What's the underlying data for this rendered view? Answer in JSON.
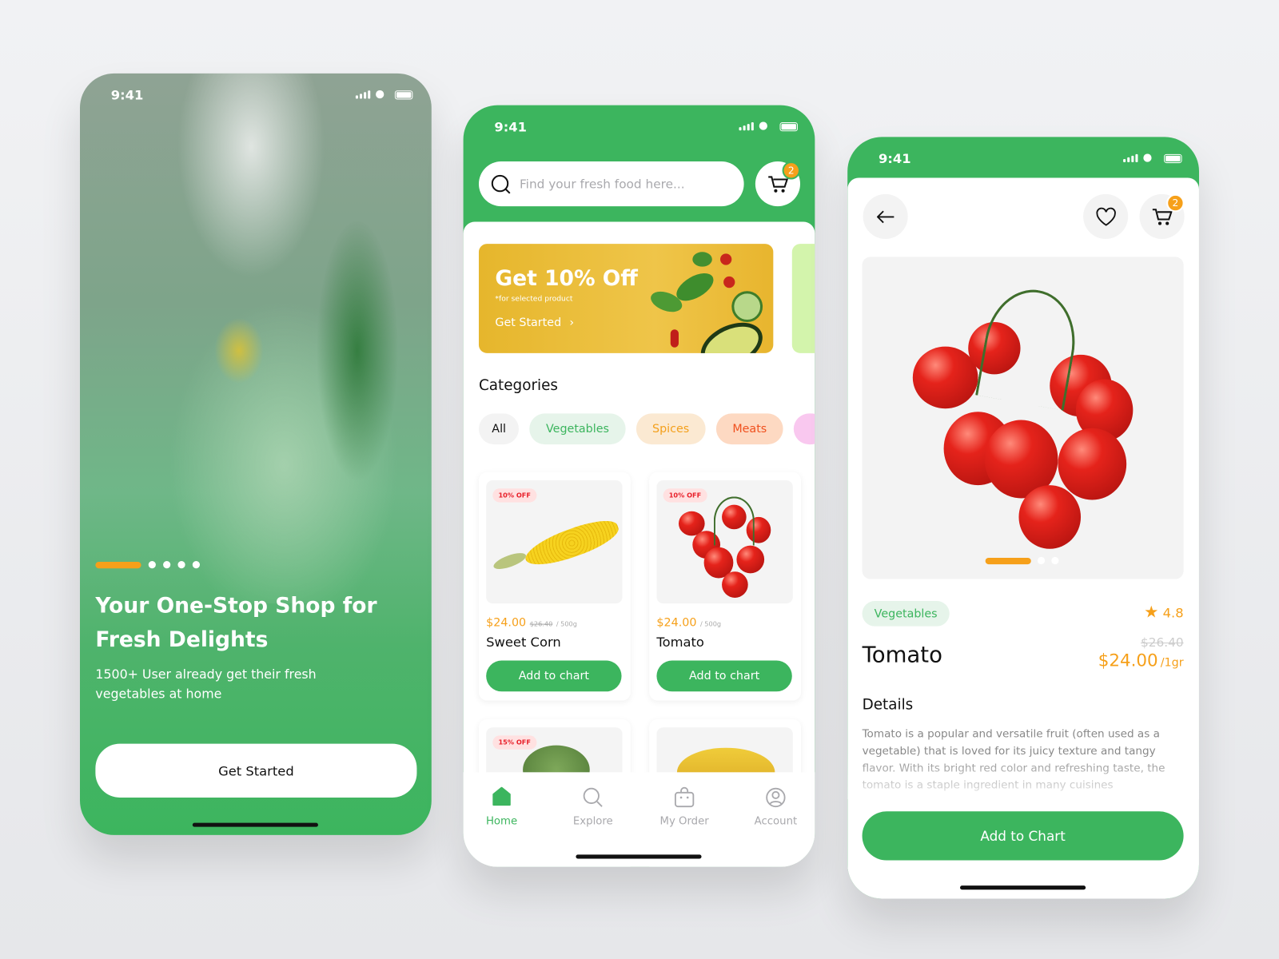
{
  "status_time": "9:41",
  "colors": {
    "brand_green": "#3cb55e",
    "accent_orange": "#f6a01a",
    "sale_red": "#e8202a"
  },
  "onboarding": {
    "title_line1": "Your One-Stop Shop for",
    "title_line2": "Fresh Delights",
    "subtitle_line1": "1500+ User already get their fresh",
    "subtitle_line2": "vegetables at home",
    "button": "Get Started",
    "pager": {
      "pages": 5,
      "active": 1
    }
  },
  "home": {
    "search_placeholder": "Find your fresh food here...",
    "cart_count": "2",
    "banner": {
      "title": "Get 10% Off",
      "note": "*for selected product",
      "cta": "Get Started"
    },
    "categories_title": "Categories",
    "categories": [
      {
        "label": "All",
        "bg": "#f3f3f3",
        "fg": "#111111"
      },
      {
        "label": "Vegetables",
        "bg": "#e6f4ea",
        "fg": "#3cb55e"
      },
      {
        "label": "Spices",
        "bg": "#fbe9d2",
        "fg": "#f4a01c"
      },
      {
        "label": "Meats",
        "bg": "#fdd9c2",
        "fg": "#f0511f"
      }
    ],
    "products": [
      {
        "badge": "10% OFF",
        "price": "$24.00",
        "old_price": "$26.40",
        "unit": "/ 500g",
        "name": "Sweet Corn",
        "button": "Add to chart",
        "image": "corn"
      },
      {
        "badge": "10% OFF",
        "price": "$24.00",
        "old_price": "",
        "unit": "/ 500g",
        "name": "Tomato",
        "button": "Add to chart",
        "image": "tomato"
      },
      {
        "badge": "15% OFF",
        "image": "broccoli"
      },
      {
        "badge": "",
        "image": "banana"
      }
    ],
    "nav": [
      {
        "label": "Home",
        "icon": "home-icon",
        "active": true
      },
      {
        "label": "Explore",
        "icon": "search-icon",
        "active": false
      },
      {
        "label": "My Order",
        "icon": "bag-icon",
        "active": false
      },
      {
        "label": "Account",
        "icon": "user-icon",
        "active": false
      }
    ]
  },
  "detail": {
    "cart_count": "2",
    "category": "Vegetables",
    "rating": "4.8",
    "old_price": "$26.40",
    "name": "Tomato",
    "price": "$24.00",
    "unit": "/1gr",
    "details_title": "Details",
    "description": "Tomato is a popular and versatile fruit (often used as a vegetable) that is loved for its juicy texture and tangy flavor. With its bright red color and refreshing taste, the tomato is a staple ingredient in many cuisines",
    "button": "Add to Chart",
    "pager": {
      "pages": 3,
      "active": 1
    }
  }
}
